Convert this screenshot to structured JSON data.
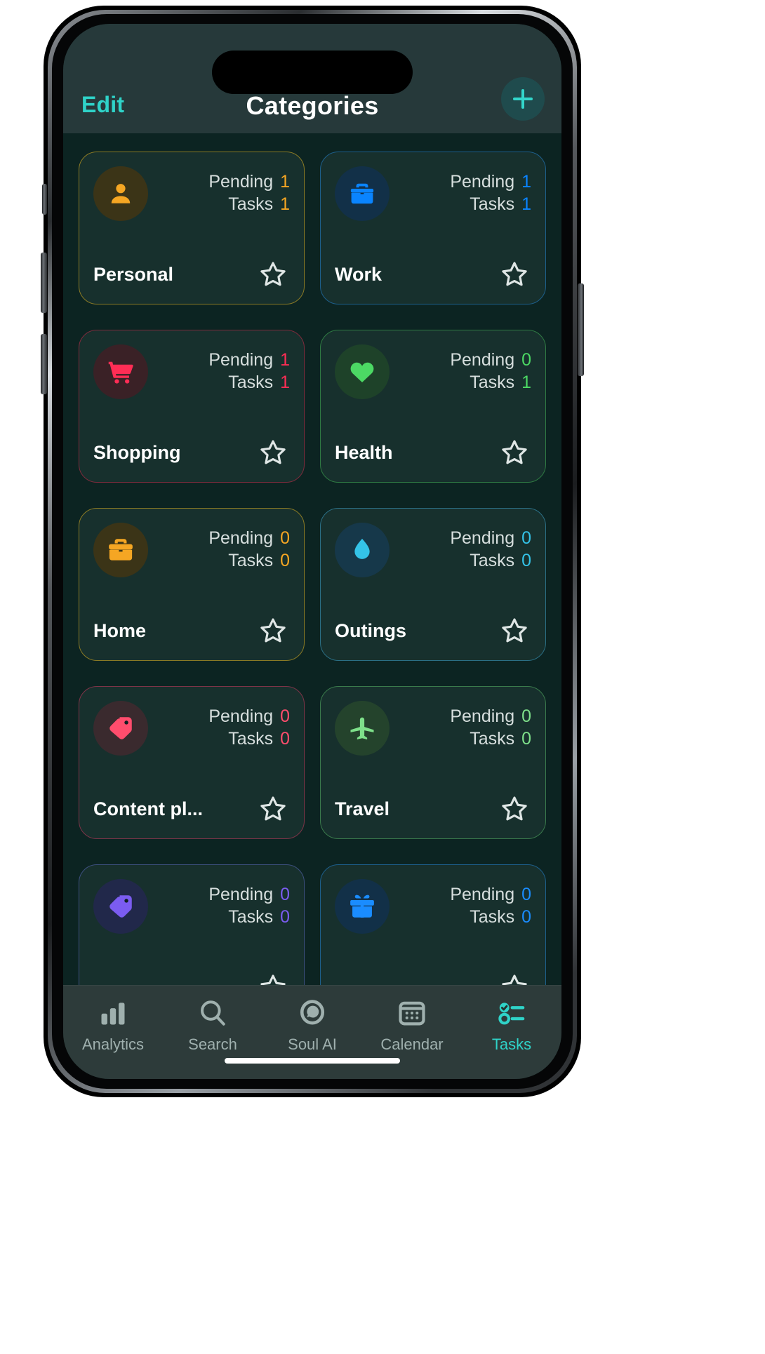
{
  "app": {
    "nav": {
      "edit_label": "Edit",
      "title": "Categories",
      "add_label": "+"
    },
    "colors": {
      "accent": "#2fd3c8",
      "screen_bg": "#0c2422",
      "navbar_bg": "#26393a",
      "tabbar_bg": "#2d3b3a",
      "card_bg": "#17302d"
    },
    "labels": {
      "pending": "Pending",
      "tasks": "Tasks"
    },
    "categories": [
      {
        "title": "Personal",
        "icon": "person-icon",
        "pending": "1",
        "tasks": "1",
        "color": "#f5a623",
        "circle_bg": "#3b3417",
        "border": "#8a7a25",
        "starred": false
      },
      {
        "title": "Work",
        "icon": "briefcase-icon",
        "pending": "1",
        "tasks": "1",
        "color": "#0a84ff",
        "circle_bg": "#123048",
        "border": "#1d5f8c",
        "starred": false
      },
      {
        "title": "Shopping",
        "icon": "shopping-cart-icon",
        "pending": "1",
        "tasks": "1",
        "color": "#ff2d55",
        "circle_bg": "#3a2126",
        "border": "#7d2b3c",
        "starred": false
      },
      {
        "title": "Health",
        "icon": "heart-icon",
        "pending": "0",
        "tasks": "1",
        "color": "#4cd964",
        "circle_bg": "#1e4229",
        "border": "#2f7a43",
        "starred": false
      },
      {
        "title": "Home",
        "icon": "toolbox-icon",
        "pending": "0",
        "tasks": "0",
        "color": "#f5a623",
        "circle_bg": "#3b3417",
        "border": "#8a7a25",
        "starred": false
      },
      {
        "title": "Outings",
        "icon": "droplet-icon",
        "pending": "0",
        "tasks": "0",
        "color": "#34c3e8",
        "circle_bg": "#16384a",
        "border": "#2b6f85",
        "starred": false
      },
      {
        "title": "Content pl...",
        "icon": "tag-icon",
        "pending": "0",
        "tasks": "0",
        "color": "#ff4d6d",
        "circle_bg": "#3a2a2e",
        "border": "#7d3448",
        "starred": false
      },
      {
        "title": "Travel",
        "icon": "airplane-icon",
        "pending": "0",
        "tasks": "0",
        "color": "#7ee08a",
        "circle_bg": "#24432c",
        "border": "#3a7a4c",
        "starred": false
      },
      {
        "title": "",
        "icon": "tag-icon",
        "pending": "0",
        "tasks": "0",
        "color": "#7b5cf0",
        "circle_bg": "#21284a",
        "border": "#3c4f7d",
        "starred": false
      },
      {
        "title": "",
        "icon": "gift-icon",
        "pending": "0",
        "tasks": "0",
        "color": "#1a8cff",
        "circle_bg": "#123048",
        "border": "#1d5f8c",
        "starred": false
      }
    ],
    "tabs": [
      {
        "label": "Analytics",
        "icon": "bar-chart-icon",
        "active": false
      },
      {
        "label": "Search",
        "icon": "search-icon",
        "active": false
      },
      {
        "label": "Soul AI",
        "icon": "chat-bubble-icon",
        "active": false
      },
      {
        "label": "Calendar",
        "icon": "calendar-icon",
        "active": false
      },
      {
        "label": "Tasks",
        "icon": "checklist-icon",
        "active": true
      }
    ]
  }
}
